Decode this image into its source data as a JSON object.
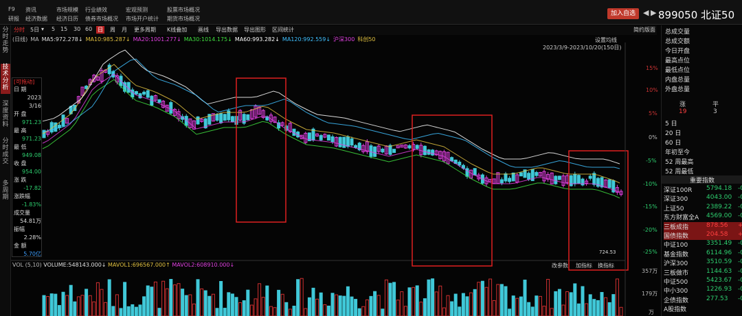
{
  "menu": {
    "row1": [
      "F9",
      "资讯",
      "市场规模",
      "行业绩效",
      "宏观预测",
      "股票市场概况"
    ],
    "row2": [
      "研报",
      "经济数据",
      "经济日历",
      "债券市场概况",
      "市场开户统计",
      "期货市场概况"
    ],
    "add_watchlist": "加入自选",
    "nav_prev": "◀",
    "nav_next": "▶",
    "stock_code": "899050",
    "stock_name": "北证50"
  },
  "toolbar": {
    "items": [
      "分时",
      "5日",
      "▾",
      "5",
      "15",
      "30",
      "60",
      "日",
      "周",
      "月",
      "更多周期",
      "K线叠加",
      "画线",
      "导出数据",
      "导出图形",
      "区间统计"
    ],
    "active_index": 7,
    "indicator_link": "简约版面"
  },
  "left_tabs": [
    "分时走势",
    "技术分析",
    "深度资料",
    "分时成交",
    "多周期"
  ],
  "ma_legend": {
    "period": "(日线)",
    "ma": "MA",
    "ma5": "MA5:972.278↓",
    "ma10": "MA10:985.287↓",
    "ma20": "MA20:1001.277↓",
    "ma30": "MA30:1014.175↓",
    "ma60": "MA60:993.282↓",
    "ma120": "MA120:992.559↓",
    "hs300": "沪深300",
    "kc50": "科创50"
  },
  "chart_header": {
    "settings": "设置均线",
    "range": "2023/3/9-2023/10/20(150日)",
    "low_label": "724.53",
    "volume_legend": {
      "vol": "VOL (5,10)",
      "volume": "VOLUME:548143.000↓",
      "mavol1": "MAVOL1:696567.000↑",
      "mavol2": "MAVOL2:608910.000↓"
    },
    "vol_buttons": [
      "改参数",
      "加指标",
      "换指标"
    ]
  },
  "axis": {
    "pct": [
      "15%",
      "10%",
      "5%",
      "0%",
      "-5%",
      "-10%",
      "-15%",
      "-20%",
      "-25%"
    ],
    "vol": [
      "357万",
      "179万",
      "万"
    ]
  },
  "info_panel": {
    "mode": "[可拖动]",
    "rows": [
      {
        "label": "日    期",
        "value": ""
      },
      {
        "label": "",
        "value": "2023"
      },
      {
        "label": "",
        "value": "3/16"
      },
      {
        "label": "开    盘",
        "value": ""
      },
      {
        "label": "",
        "value": "971.23",
        "color": "g"
      },
      {
        "label": "最    高",
        "value": ""
      },
      {
        "label": "",
        "value": "971.23",
        "color": "g"
      },
      {
        "label": "最    低",
        "value": ""
      },
      {
        "label": "",
        "value": "949.08",
        "color": "g"
      },
      {
        "label": "收    盘",
        "value": ""
      },
      {
        "label": "",
        "value": "954.00",
        "color": "g"
      },
      {
        "label": "涨    跌",
        "value": ""
      },
      {
        "label": "",
        "value": "-17.82",
        "color": "g"
      },
      {
        "label": "涨跌幅",
        "value": ""
      },
      {
        "label": "",
        "value": "-1.83%",
        "color": "g"
      },
      {
        "label": "成交量",
        "value": ""
      },
      {
        "label": "",
        "value": "54.81万"
      },
      {
        "label": "振幅",
        "value": ""
      },
      {
        "label": "",
        "value": "2.28%"
      },
      {
        "label": "金    额",
        "value": ""
      },
      {
        "label": "",
        "value": "5.70亿",
        "color": "b"
      }
    ]
  },
  "right_panel": {
    "stats": [
      "总成交量",
      "总成交额",
      "今日开盘",
      "最高点位",
      "最低点位",
      "内盘总量",
      "外盘总量"
    ],
    "rise_label": "涨",
    "flat_label": "平",
    "rise_count": "19",
    "flat_count": "3",
    "periods": [
      "5 日",
      "20 日",
      "60 日",
      "年初至今",
      "52 周最高",
      "52 周最低"
    ],
    "index_header": "重要指数",
    "indices": [
      {
        "name": "深证100R",
        "value": "5794.18",
        "chg": "-0",
        "color": "g"
      },
      {
        "name": "深证300",
        "value": "4043.00",
        "chg": "-0",
        "color": "g"
      },
      {
        "name": "上证50",
        "value": "2389.22",
        "chg": "-0",
        "color": "g"
      },
      {
        "name": "东方财富全A",
        "value": "4569.00",
        "chg": "-0",
        "color": "g"
      },
      {
        "name": "三板成指",
        "value": "878.56",
        "chg": "+0",
        "color": "rd",
        "hl": true
      },
      {
        "name": "国债指数",
        "value": "204.58",
        "chg": "+0",
        "color": "rd",
        "hl": true
      },
      {
        "name": "中证100",
        "value": "3351.49",
        "chg": "-0",
        "color": "g"
      },
      {
        "name": "基金指数",
        "value": "6114.96",
        "chg": "-0",
        "color": "g"
      },
      {
        "name": "沪深300",
        "value": "3510.59",
        "chg": "-0",
        "color": "g"
      },
      {
        "name": "三板做市",
        "value": "1144.63",
        "chg": "-0",
        "color": "g"
      },
      {
        "name": "中证500",
        "value": "5423.67",
        "chg": "-0",
        "color": "g"
      },
      {
        "name": "中小300",
        "value": "1226.93",
        "chg": "-0",
        "color": "g"
      },
      {
        "name": "企债指数",
        "value": "277.53",
        "chg": "-0",
        "color": "g"
      },
      {
        "name": "A股指数",
        "value": "",
        "chg": "",
        "color": "g"
      }
    ]
  },
  "colors": {
    "up": "#e040e0",
    "down": "#40c8d8",
    "ma5": "#e0e0e0",
    "ma10": "#e0c040",
    "ma20": "#e040e0",
    "ma30": "#40e040",
    "ma60": "#ffffff",
    "ma120": "#40c0ff",
    "highlight_box": "#e02020"
  },
  "chart_data": {
    "type": "candlestick",
    "range_label": "2023/3/9-2023/10/20(150日)",
    "lowest_close_label": "724.53",
    "notes": "Candlesticks of 北证50 index with MA overlays; three red rectangles highlight declining periods."
  }
}
